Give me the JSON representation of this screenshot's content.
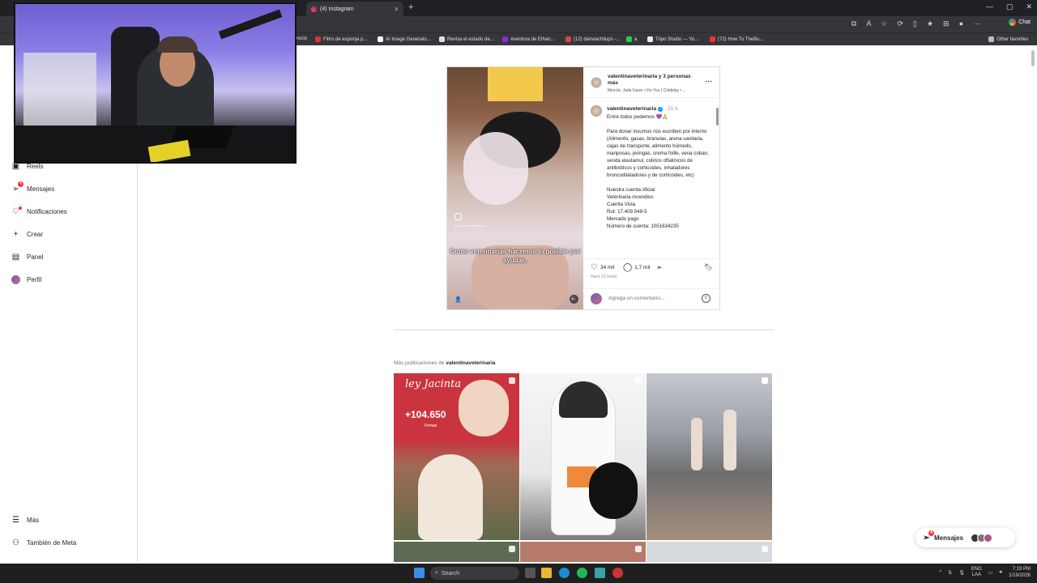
{
  "browser": {
    "active_tab": "(4) Instagram",
    "tab_close": "×",
    "new_tab": "+",
    "chat_label": "Chat",
    "other_favorites": "Other favorites",
    "bookmarks": [
      {
        "label": "recio"
      },
      {
        "label": "Filtro de esponja p..."
      },
      {
        "label": "AI Image Generato..."
      },
      {
        "label": "Revisa el estado de..."
      },
      {
        "label": "Aventura de Ethan..."
      },
      {
        "label": "(12) danwachilups -..."
      },
      {
        "label": "a"
      },
      {
        "label": "Tripo Studio --- Yo..."
      },
      {
        "label": "(72) How To TheBu..."
      }
    ]
  },
  "sidebar": {
    "items": [
      {
        "label": "Reels",
        "icon": "reels-icon"
      },
      {
        "label": "Mensajes",
        "icon": "messages-icon",
        "badge": "4"
      },
      {
        "label": "Notificaciones",
        "icon": "heart-icon"
      },
      {
        "label": "Crear",
        "icon": "plus-icon"
      },
      {
        "label": "Panel",
        "icon": "dashboard-icon"
      },
      {
        "label": "Perfil",
        "icon": "avatar"
      }
    ],
    "bottom": [
      {
        "label": "Más",
        "icon": "menu-icon"
      },
      {
        "label": "También de Meta",
        "icon": "meta-icon"
      }
    ]
  },
  "post": {
    "header_title": "valentinaveterinaria y 3 personas más",
    "music": "Mezcla: Jada Facer • Fix You | Coldplay • ...",
    "media_caption": "Como veterinarias hacemos lo posible por ayudar..",
    "media_user_tag": "@VALENTINAVETERINARIA",
    "caption_user": "valentinaveterinaria",
    "caption_time": "21 h",
    "caption_text": "Entre todos podemos 💜🙏\n\nPara donar insumos nos escriben por interno\n(Alimento, gasas, branulas, arena sanitaria, cajas de transporte, alimento húmedo, mariposas, jeringas, crema foille, vena coban, venda elastamul, colirios oftalmicos de antibióticos y corticoides, inhaladores broncodilatadores y de corticoides, etc)\n\nNuestra cuenta oficial\nVeterinaria incendios\nCuenta Vista\nRut: 17.409.548-5\nMercado pago\nNúmero de cuenta: 1051634235",
    "likes": "34 mil",
    "comments": "1,7 mil",
    "posted": "Hace 21 horas",
    "comment_placeholder": "Agrega un comentario..."
  },
  "more": {
    "prefix": "Más publicaciones de",
    "user": "valentinaveterinaria"
  },
  "grid": {
    "c1_title": "ley Jacinta",
    "c1_count": "+104.650",
    "c1_sub": "Firmas"
  },
  "messages_pill": {
    "label": "Mensajes",
    "badge": "4"
  },
  "taskbar": {
    "search": "Search",
    "lang_top": "ENG",
    "lang_bottom": "LAA",
    "time": "7:19 PM",
    "date": "1/19/2026"
  },
  "colors": {
    "accent": "#0095f6",
    "notification": "#ff3040"
  }
}
